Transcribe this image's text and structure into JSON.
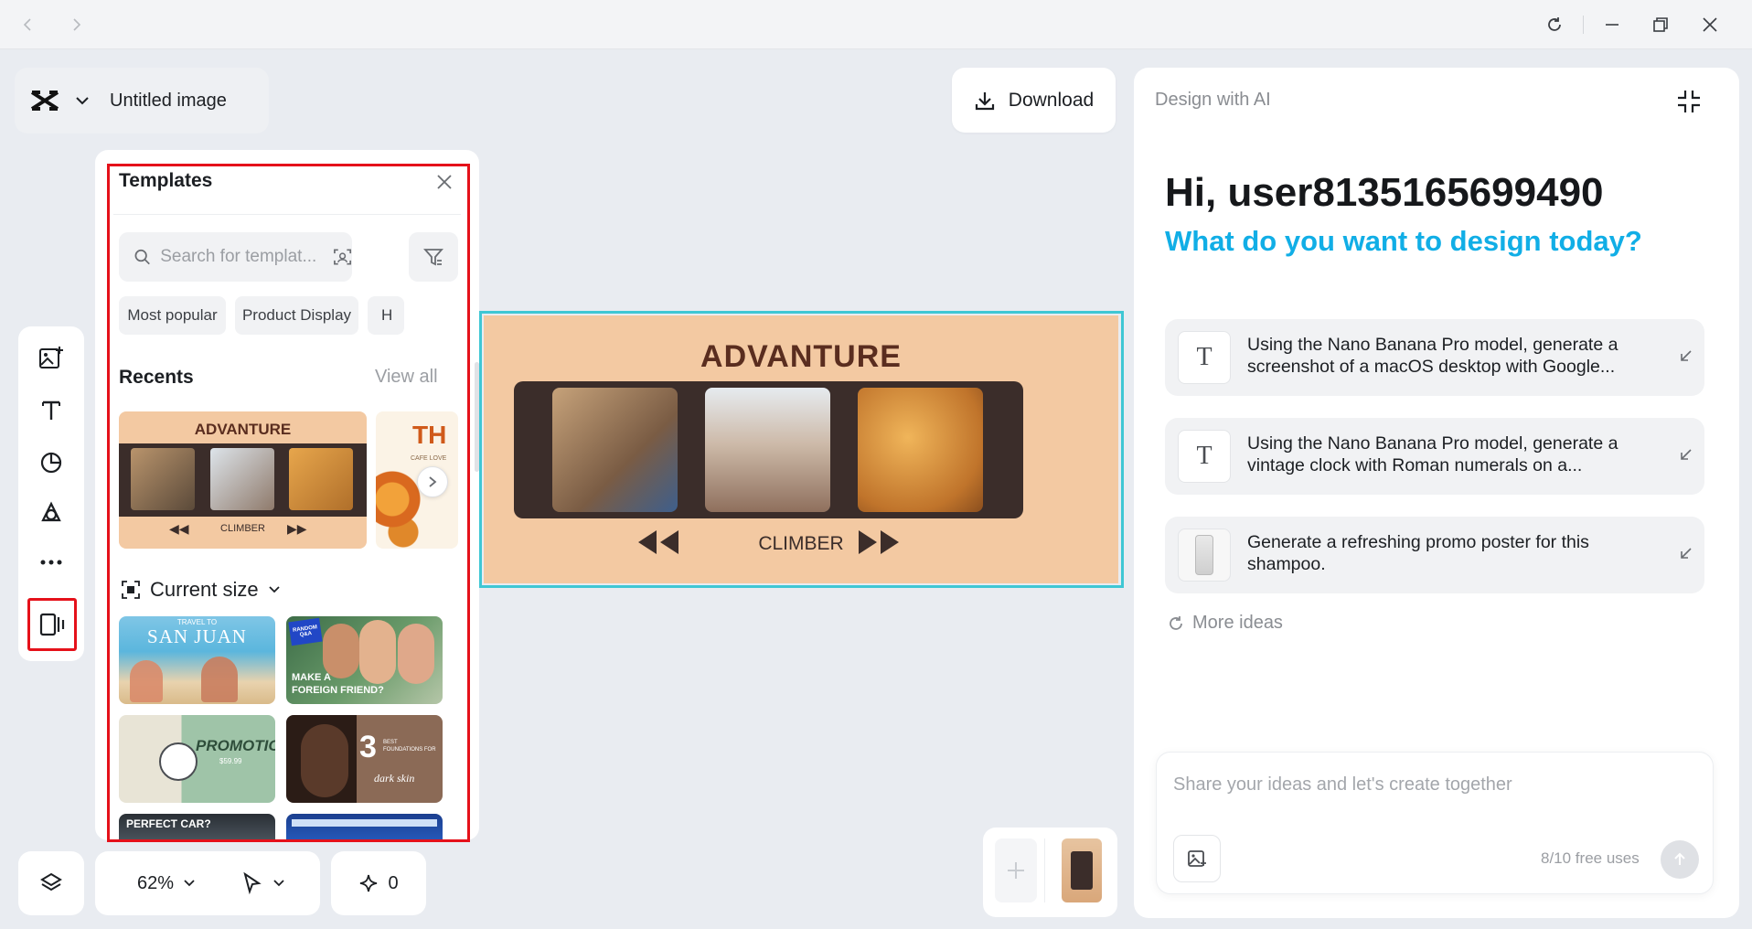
{
  "titlebar": {
    "back": "back-icon",
    "forward": "forward-icon",
    "reload": "reload-icon",
    "minimize": "minimize-icon",
    "restore": "restore-icon",
    "close": "close-icon"
  },
  "project": {
    "title": "Untitled image"
  },
  "header": {
    "download_label": "Download"
  },
  "templates": {
    "title": "Templates",
    "search_placeholder": "Search for templat...",
    "chips": [
      "Most popular",
      "Product Display",
      "H"
    ],
    "recents_title": "Recents",
    "view_all": "View all",
    "recent_item": {
      "title": "ADVANTURE",
      "caption": "CLIMBER"
    },
    "recent_item2": {
      "title": "TH",
      "caption": "CAFE LOVE"
    },
    "size_label": "Current size",
    "grid": [
      {
        "line1": "SAN JUAN",
        "line2": "TRAVEL TO"
      },
      {
        "line1": "MAKE A",
        "line2": "FOREIGN FRIEND?",
        "badge": "RANDOM Q&A"
      },
      {
        "line1": "PROMOTION",
        "line2": "$59.99"
      },
      {
        "line1": "3",
        "line2": "BEST FOUNDATIONS FOR",
        "line3": "dark skin"
      },
      {
        "line1": "PERFECT CAR?"
      },
      {
        "line1": ""
      }
    ]
  },
  "canvas": {
    "title": "ADVANTURE",
    "caption": "CLIMBER",
    "colors": {
      "bg": "#f3c9a2",
      "film": "#3b2d2a",
      "title": "#5a2d1f",
      "selection": "#3fc7d4"
    }
  },
  "toolbar": {
    "zoom": "62%",
    "credits": "0"
  },
  "ai": {
    "header": "Design with AI",
    "greeting": "Hi, user8135165699490",
    "prompt_title": "What do you want to design today?",
    "ideas": [
      {
        "icon": "T",
        "text": "Using the Nano Banana Pro model, generate a screenshot of a macOS desktop with Google..."
      },
      {
        "icon": "T",
        "text": "Using the Nano Banana Pro model, generate a vintage clock with Roman numerals on a..."
      },
      {
        "icon": "shampoo",
        "text": "Generate a refreshing promo poster for this shampoo."
      }
    ],
    "more_ideas": "More ideas",
    "composer_placeholder": "Share your ideas and let's create together",
    "free_uses": "8/10 free uses"
  }
}
